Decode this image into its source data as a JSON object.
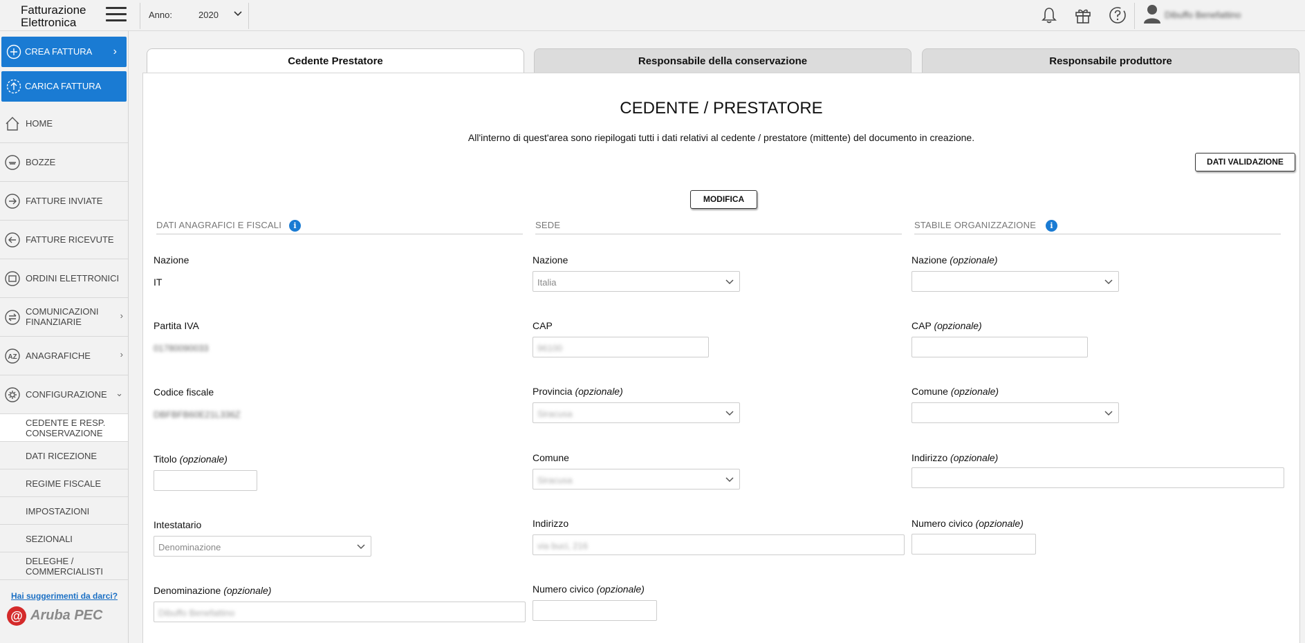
{
  "topbar": {
    "logo_line1": "Fatturazione",
    "logo_line2": "Elettronica",
    "year_label": "Anno:",
    "year_value": "2020",
    "user_name": "Dibuffo Benefattino"
  },
  "sidebar": {
    "create_invoice": "CREA FATTURA",
    "upload_invoice": "CARICA FATTURA",
    "items": [
      {
        "label": "HOME",
        "icon": "home-icon"
      },
      {
        "label": "BOZZE",
        "icon": "drafts-icon"
      },
      {
        "label": "FATTURE INVIATE",
        "icon": "sent-icon"
      },
      {
        "label": "FATTURE RICEVUTE",
        "icon": "received-icon"
      },
      {
        "label": "ORDINI ELETTRONICI",
        "icon": "orders-icon"
      },
      {
        "label": "COMUNICAZIONI FINANZIARIE",
        "icon": "exchange-icon"
      },
      {
        "label": "ANAGRAFICHE",
        "icon": "az-icon"
      },
      {
        "label": "CONFIGURAZIONE",
        "icon": "gear-icon"
      }
    ],
    "sub_items": [
      {
        "label": "CEDENTE E RESP. CONSERVAZIONE",
        "active": true
      },
      {
        "label": "DATI RICEZIONE"
      },
      {
        "label": "REGIME FISCALE"
      },
      {
        "label": "IMPOSTAZIONI"
      },
      {
        "label": "SEZIONALI"
      },
      {
        "label": "DELEGHE / COMMERCIALISTI"
      }
    ],
    "suggest_link": "Hai suggerimenti da darci?",
    "brand": "Aruba PEC"
  },
  "tabs": [
    "Cedente Prestatore",
    "Responsabile della conservazione",
    "Responsabile produttore"
  ],
  "main": {
    "title": "CEDENTE / PRESTATORE",
    "description": "All'interno di quest'area sono riepilogati tutti i dati relativi al cedente / prestatore (mittente) del documento in creazione.",
    "validate_button": "DATI VALIDAZIONE",
    "edit_button": "MODIFICA"
  },
  "sections": {
    "anagrafici": "DATI ANAGRAFICI E FISCALI",
    "sede": "SEDE",
    "stabile": "STABILE ORGANIZZAZIONE"
  },
  "optional": "(opzionale)",
  "anagrafici": {
    "nazione_label": "Nazione",
    "nazione_value": "IT",
    "piva_label": "Partita IVA",
    "piva_value": "01780090033",
    "cf_label": "Codice fiscale",
    "cf_value": "DBFBFB60E21L336Z",
    "titolo_label": "Titolo",
    "intestatario_label": "Intestatario",
    "intestatario_value": "Denominazione",
    "denominazione_label": "Denominazione",
    "denominazione_value": "Dibuffo Benefattino"
  },
  "sede": {
    "nazione_label": "Nazione",
    "nazione_value": "Italia",
    "cap_label": "CAP",
    "cap_value": "96100",
    "provincia_label": "Provincia",
    "provincia_value": "Siracusa",
    "comune_label": "Comune",
    "comune_value": "Siracusa",
    "indirizzo_label": "Indirizzo",
    "indirizzo_value": "via buci, 216",
    "civico_label": "Numero civico"
  },
  "stabile": {
    "nazione_label": "Nazione",
    "cap_label": "CAP",
    "comune_label": "Comune",
    "indirizzo_label": "Indirizzo",
    "civico_label": "Numero civico"
  },
  "colors": {
    "primary": "#1a7bd3",
    "background": "#f2f2f2"
  }
}
